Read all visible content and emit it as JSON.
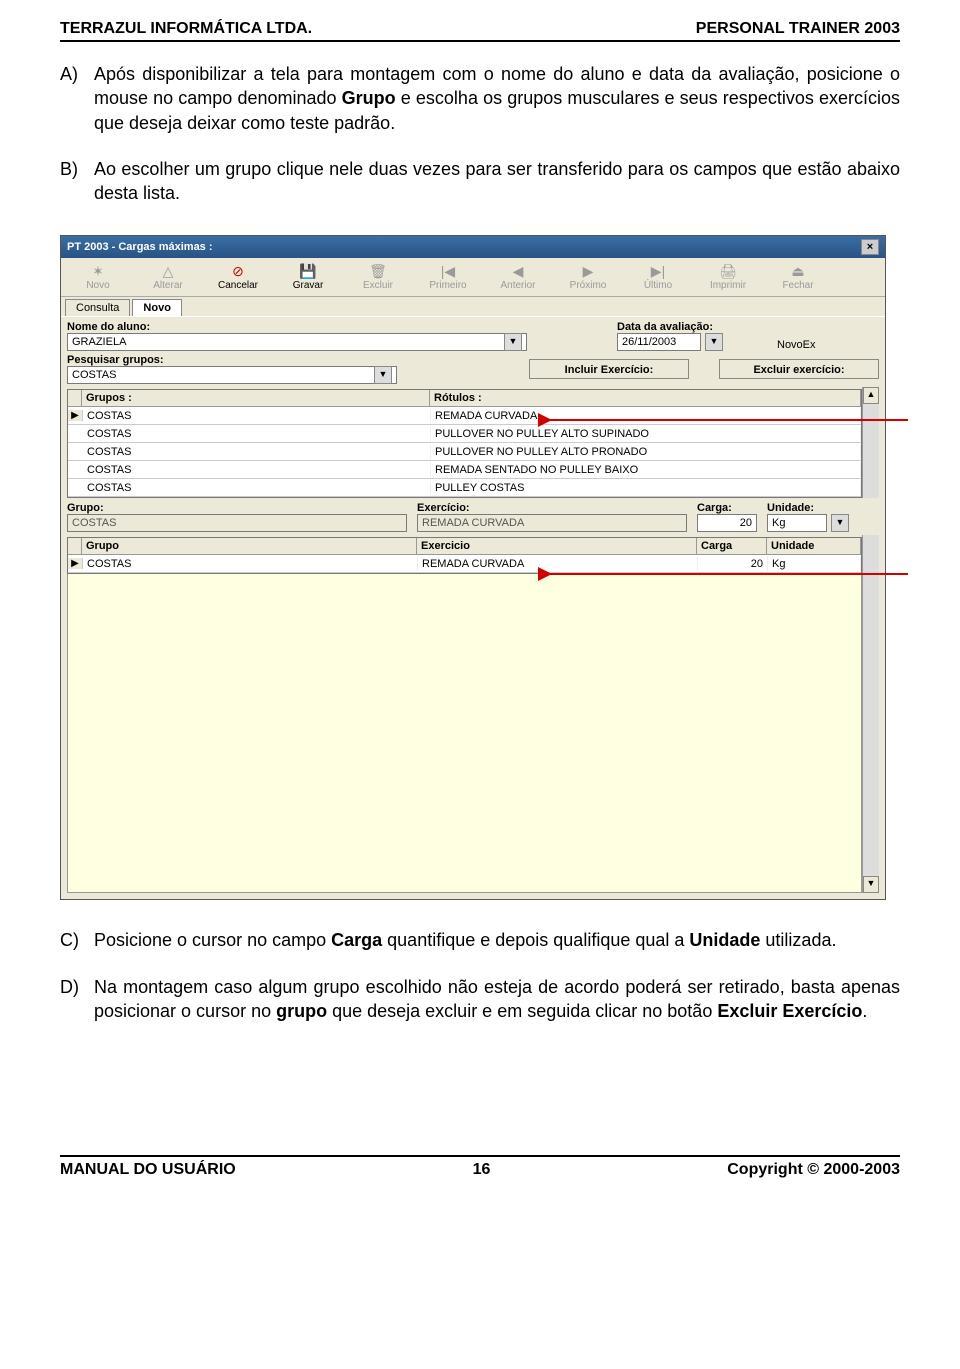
{
  "header": {
    "left": "TERRAZUL INFORMÁTICA LTDA.",
    "right": "PERSONAL TRAINER 2003"
  },
  "paragraphs": {
    "a_label": "A)",
    "a_pre": "Após disponibilizar a tela para montagem com o nome do aluno e data da avaliação, posicione o mouse no campo denominado ",
    "a_bold": "Grupo",
    "a_post": " e escolha os grupos musculares e seus respectivos exercícios que deseja deixar como teste padrão.",
    "b_label": "B)",
    "b_text": "Ao escolher um grupo clique nele duas vezes para ser transferido para os campos que estão abaixo desta lista.",
    "c_label": "C)",
    "c_pre": "Posicione o cursor no campo ",
    "c_bold1": "Carga",
    "c_mid": " quantifique e depois qualifique qual a ",
    "c_bold2": "Unidade",
    "c_post": " utilizada.",
    "d_label": "D)",
    "d_pre": "Na montagem caso algum grupo escolhido não esteja de acordo poderá ser retirado, basta apenas posicionar o cursor no ",
    "d_bold1": "grupo",
    "d_mid": " que deseja excluir e em seguida clicar no botão ",
    "d_bold2": "Excluir Exercício",
    "d_post": "."
  },
  "app": {
    "title": "PT 2003 - Cargas máximas :",
    "toolbar": {
      "novo": "Novo",
      "alterar": "Alterar",
      "cancelar": "Cancelar",
      "gravar": "Gravar",
      "excluir": "Excluir",
      "primeiro": "Primeiro",
      "anterior": "Anterior",
      "proximo": "Próximo",
      "ultimo": "Último",
      "imprimir": "Imprimir",
      "fechar": "Fechar"
    },
    "tabs": {
      "consulta": "Consulta",
      "novo": "Novo"
    },
    "labels": {
      "nome_aluno": "Nome do aluno:",
      "data_avaliacao": "Data da avaliação:",
      "novoex": "NovoEx",
      "pesquisar_grupos": "Pesquisar grupos:",
      "incluir": "Incluir Exercício:",
      "excluir_ex": "Excluir exercício:"
    },
    "fields": {
      "nome_aluno": "GRAZIELA",
      "data_avaliacao": "26/11/2003",
      "pesquisar_grupos": "COSTAS"
    },
    "grid1": {
      "h1": "Grupos :",
      "h2": "Rótulos :",
      "rows": [
        {
          "g": "COSTAS",
          "r": "REMADA CURVADA"
        },
        {
          "g": "COSTAS",
          "r": "PULLOVER  NO PULLEY ALTO SUPINADO"
        },
        {
          "g": "COSTAS",
          "r": "PULLOVER  NO PULLEY ALTO PRONADO"
        },
        {
          "g": "COSTAS",
          "r": "REMADA SENTADO NO PULLEY BAIXO"
        },
        {
          "g": "COSTAS",
          "r": "PULLEY COSTAS"
        }
      ]
    },
    "detail": {
      "grupo_lbl": "Grupo:",
      "exercicio_lbl": "Exercício:",
      "carga_lbl": "Carga:",
      "unidade_lbl": "Unidade:",
      "grupo": "COSTAS",
      "exercicio": "REMADA CURVADA",
      "carga": "20",
      "unidade": "Kg"
    },
    "grid2": {
      "h1": "Grupo",
      "h2": "Exercicio",
      "h3": "Carga",
      "h4": "Unidade",
      "rows": [
        {
          "g": "COSTAS",
          "e": "REMADA CURVADA",
          "c": "20",
          "u": "Kg"
        }
      ]
    }
  },
  "footer": {
    "left": "MANUAL DO USUÁRIO",
    "page": "16",
    "right": "Copyright © 2000-2003"
  }
}
